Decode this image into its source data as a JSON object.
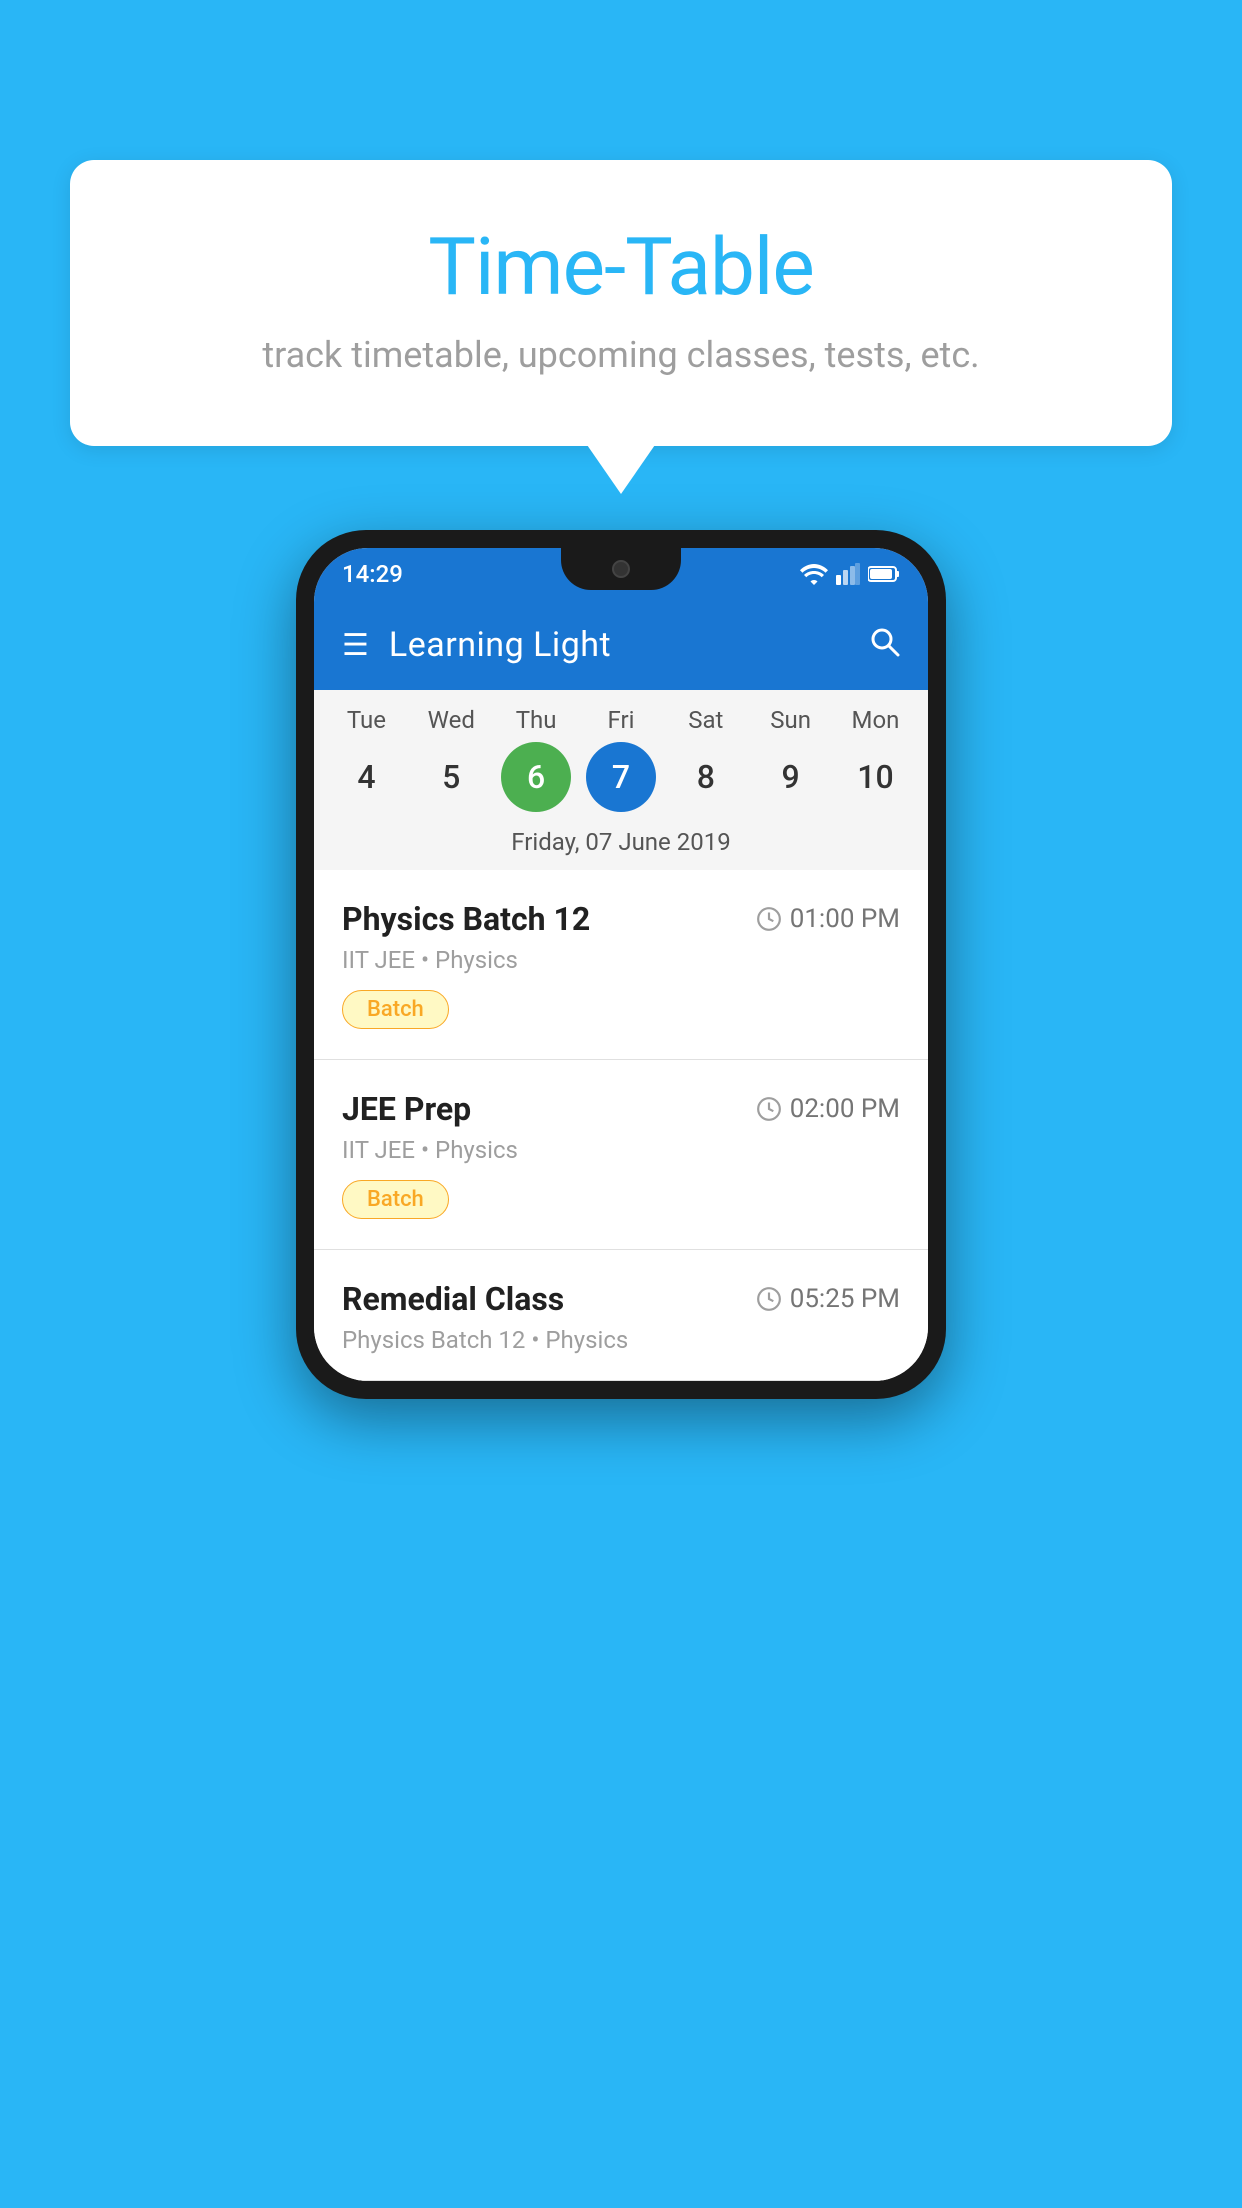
{
  "page": {
    "background_color": "#29B6F6"
  },
  "bubble": {
    "title": "Time-Table",
    "subtitle": "track timetable, upcoming classes, tests, etc."
  },
  "phone": {
    "status_bar": {
      "time": "14:29"
    },
    "toolbar": {
      "app_name": "Learning Light"
    },
    "calendar": {
      "days": [
        {
          "name": "Tue",
          "number": "4",
          "state": "normal"
        },
        {
          "name": "Wed",
          "number": "5",
          "state": "normal"
        },
        {
          "name": "Thu",
          "number": "6",
          "state": "today"
        },
        {
          "name": "Fri",
          "number": "7",
          "state": "selected"
        },
        {
          "name": "Sat",
          "number": "8",
          "state": "normal"
        },
        {
          "name": "Sun",
          "number": "9",
          "state": "normal"
        },
        {
          "name": "Mon",
          "number": "10",
          "state": "normal"
        }
      ],
      "selected_date_label": "Friday, 07 June 2019"
    },
    "schedule": [
      {
        "title": "Physics Batch 12",
        "time": "01:00 PM",
        "subtitle": "IIT JEE • Physics",
        "badge": "Batch"
      },
      {
        "title": "JEE Prep",
        "time": "02:00 PM",
        "subtitle": "IIT JEE • Physics",
        "badge": "Batch"
      },
      {
        "title": "Remedial Class",
        "time": "05:25 PM",
        "subtitle": "Physics Batch 12 • Physics",
        "badge": null
      }
    ]
  }
}
